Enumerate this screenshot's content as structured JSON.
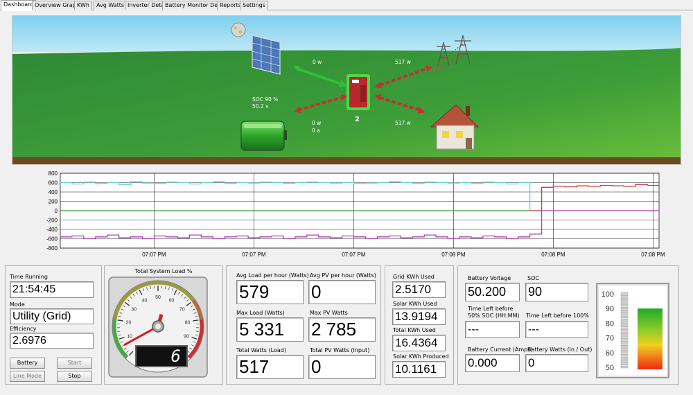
{
  "tabs": [
    "Dashboard",
    "Overview Graph",
    "KWh",
    "Avg Watts",
    "Inverter Detail",
    "Battery Monitor Detail",
    "Reports",
    "Settings"
  ],
  "scene": {
    "pv_watts": "0 w",
    "grid_watts": "517 w",
    "soc_label": "SOC 90 %",
    "battery_voltage": "50.2 v",
    "battery_watts": "0 w",
    "battery_amps": "0 a",
    "inverter_count": "2",
    "load_watts": "517 w"
  },
  "chart_data": {
    "type": "line",
    "y_ticks": [
      "800",
      "600",
      "400",
      "200",
      "0",
      "-200",
      "-400",
      "-600",
      "-800"
    ],
    "ylim": [
      -800,
      800
    ],
    "x_ticks": [
      "07:07 PM",
      "07:07 PM",
      "07:07 PM",
      "07:08 PM",
      "07:08 PM",
      "07:08 PM"
    ],
    "grid": true,
    "series": [
      {
        "color": "#5fd3d3",
        "values": [
          600,
          570,
          610,
          580,
          600,
          560,
          620,
          590,
          580,
          610,
          600,
          570,
          600,
          620,
          580,
          600,
          590,
          610,
          600,
          580,
          600,
          610,
          600,
          590,
          600,
          580,
          590,
          600,
          620,
          600,
          580,
          610,
          600,
          590,
          600,
          580,
          610,
          600,
          570,
          600,
          0,
          0,
          0,
          0,
          0,
          0,
          0,
          0,
          0,
          0,
          0,
          0
        ]
      },
      {
        "color": "#d03a3a",
        "values": [
          null,
          null,
          null,
          null,
          null,
          null,
          null,
          null,
          null,
          null,
          null,
          null,
          null,
          null,
          null,
          null,
          null,
          null,
          null,
          null,
          null,
          null,
          null,
          null,
          null,
          null,
          null,
          null,
          null,
          null,
          null,
          null,
          null,
          null,
          null,
          null,
          null,
          null,
          null,
          null,
          0,
          500,
          520,
          510,
          530,
          520,
          540,
          530,
          520,
          560,
          540,
          520
        ]
      },
      {
        "color": "#b040b0",
        "values": [
          -560,
          -540,
          -600,
          -560,
          -520,
          -580,
          -560,
          -600,
          -540,
          -560,
          -580,
          -520,
          -560,
          -600,
          -560,
          -540,
          -580,
          -560,
          -540,
          -600,
          -560,
          -520,
          -560,
          -580,
          -540,
          -560,
          -600,
          -560,
          -540,
          -580,
          -560,
          -520,
          -560,
          -600,
          -560,
          -580,
          -540,
          -560,
          -600,
          -560,
          -500,
          0,
          0,
          0,
          0,
          0,
          0,
          0,
          0,
          0,
          0,
          0
        ]
      },
      {
        "color": "#2fa02f",
        "values": [
          0,
          0,
          0,
          0,
          0,
          0,
          0,
          0,
          0,
          0,
          0,
          0,
          0,
          0,
          0,
          0,
          0,
          0,
          0,
          0,
          0,
          0,
          0,
          0,
          0,
          0,
          0,
          0,
          0,
          0,
          0,
          0,
          0,
          0,
          0,
          0,
          0,
          0,
          0,
          0,
          0,
          null,
          null,
          null,
          null,
          null,
          null,
          null,
          null,
          null,
          null,
          null
        ]
      }
    ]
  },
  "panel1": {
    "time_running_label": "Time Running",
    "time_running": "21:54:45",
    "mode_label": "Mode",
    "mode": "Utility (Grid)",
    "efficiency_label": "Efficiency",
    "efficiency": "2.6976",
    "battery_btn": "Battery",
    "start_btn": "Start",
    "line_mode_btn": "Line Mode",
    "stop_btn": "Stop"
  },
  "gauge": {
    "title": "Total System Load %",
    "ticks": [
      "0",
      "10",
      "20",
      "30",
      "40",
      "50",
      "60",
      "70",
      "80",
      "90",
      "100"
    ],
    "value_percent": 6,
    "digital": "6"
  },
  "panel3": {
    "avg_load_label": "Avg Load per hour (Watts)",
    "avg_load": "579",
    "avg_pv_label": "Avg PV per hour (Watts)",
    "avg_pv": "0",
    "max_load_label": "Max Load (Watts)",
    "max_load": "5 331",
    "max_pv_label": "Max PV Watts",
    "max_pv": "2 785",
    "total_watts_label": "Total Watts (Load)",
    "total_watts": "517",
    "total_pv_label": "Total PV Watts (Input)",
    "total_pv": "0"
  },
  "panel4": {
    "grid_kwh_label": "Grid KWh Used",
    "grid_kwh": "2.5170",
    "solar_kwh_used_label": "Solar KWh Used",
    "solar_kwh_used": "13.9194",
    "total_kwh_label": "Total KWh Used",
    "total_kwh": "16.4364",
    "solar_kwh_produced_label": "Solar KWh Produced",
    "solar_kwh_produced": "10.1161"
  },
  "panel5": {
    "battery_voltage_label": "Battery Voltage",
    "battery_voltage": "50.200",
    "soc_label": "SOC",
    "soc": "90",
    "time_left_50_label_1": "Time Left before",
    "time_left_50_label_2": "50% SOC (HH:MM)",
    "time_left_50": "---",
    "time_left_100_label": "Time Left before 100%",
    "time_left_100": "---",
    "battery_current_label": "Battery Current (Amps)",
    "battery_current": "0.000",
    "battery_watts_label": "Battery Watts (In / Out)",
    "battery_watts": "0"
  },
  "soc_meter": {
    "ticks": [
      "100",
      "90",
      "80",
      "70",
      "60",
      "50"
    ],
    "value_percent": 90
  },
  "colors": {
    "sky": "#8fd4ee",
    "grass": "#3f9a3a",
    "arrow_green": "#2fbf3a",
    "arrow_red": "#c43030"
  }
}
